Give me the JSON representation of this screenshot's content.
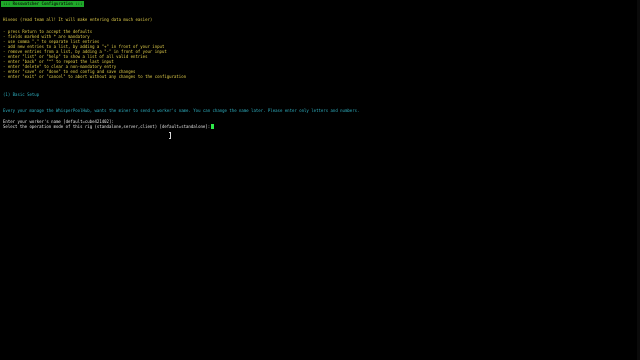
{
  "window": {
    "title": "::: Rosswatcher Configuration :::"
  },
  "intro": {
    "greeting": "Hiveos (read team all! It will make entering data much easier)"
  },
  "help_lines": [
    "- press Return to accept the defaults",
    "- fields marked with * are mandatory",
    "- use comma \",\" to separate list entries",
    "- add new entries to a list, by adding a \"+\" in front of your input",
    "- remove entries from a list, by adding a \"-\" in front of your input",
    "- enter \"list\" or \"help\" to show a list of all valid entries",
    "- enter \"back\" or \"^\" to repeat the last input",
    "- enter \"delete\" to clear a non-mandatory entry",
    "- enter \"save\" or \"done\" to end config and save changes",
    "- enter \"exit\" or \"cancel\" to abort without any changes to the configuration"
  ],
  "section": {
    "heading": "(1) Basic Setup"
  },
  "info": {
    "text": "Every your manage the WhisperPoolHub, wants the miner to send a worker's name. You can change the name later. Please enter only letters and numbers."
  },
  "prompts": {
    "worker_name": "Enter your worker's name [default=cube421402]:",
    "mode": "Select the operation mode of this rig (standalone,server,client) [default=standalone]:"
  },
  "colors": {
    "background": "#000000",
    "title_bg": "#1fa82a",
    "help": "#e3cf4a",
    "info": "#2fb3c4",
    "prompt": "#e6e6e6",
    "cursor": "#2ee84a"
  }
}
